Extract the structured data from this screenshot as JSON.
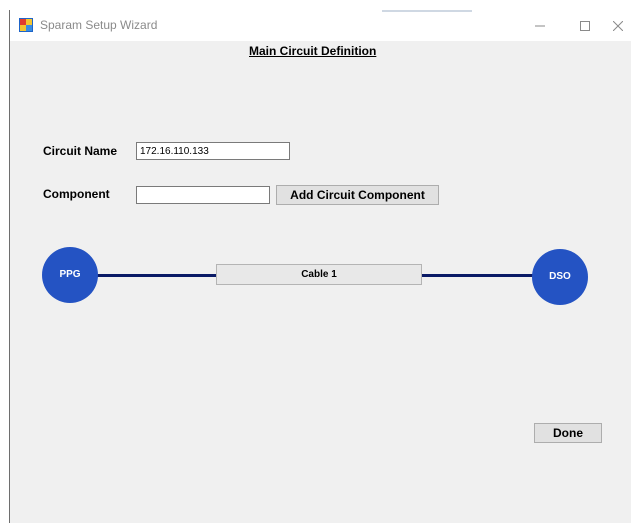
{
  "window": {
    "title": "Sparam Setup Wizard",
    "minimize_glyph": "—",
    "close_glyph": "✕"
  },
  "heading": "Main Circuit Definition",
  "form": {
    "circuit_name_label": "Circuit Name",
    "circuit_name_value": "172.16.110.133",
    "component_label": "Component",
    "component_value": "",
    "add_button_label": "Add Circuit Component"
  },
  "diagram": {
    "source_node": "PPG",
    "sink_node": "DSO",
    "components": [
      "Cable 1"
    ],
    "wire_color": "#0a1a66",
    "node_color": "#2453c3"
  },
  "done_button_label": "Done",
  "icons": {
    "app": "app-window-icon",
    "minimize": "minimize-icon",
    "maximize": "maximize-icon",
    "close": "close-icon"
  }
}
